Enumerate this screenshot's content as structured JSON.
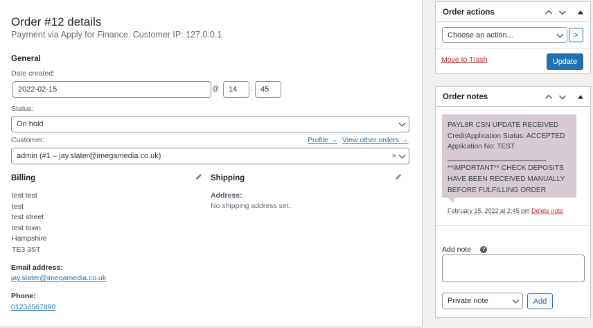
{
  "order": {
    "title": "Order #12 details",
    "subtitle": "Payment via Apply for Finance. Customer IP: 127.0.0.1"
  },
  "general": {
    "heading": "General",
    "date_label": "Date created:",
    "date_value": "2022-02-15",
    "at_sep": "@",
    "hour": "14",
    "colon_sep": ":",
    "minute": "45",
    "status_label": "Status:",
    "status_value": "On hold",
    "customer_label": "Customer:",
    "profile_link": "Profile →",
    "other_orders_link": "View other orders →",
    "customer_value": "admin (#1 – jay.slater@imegamedia.co.uk)",
    "clear_symbol": "×"
  },
  "billing": {
    "heading": "Billing",
    "address_lines": [
      "test test",
      "test",
      "test street",
      "test town",
      "Hampshire",
      "TE3 3ST"
    ],
    "email_label": "Email address:",
    "email": "jay.slater@imegamedia.co.uk",
    "phone_label": "Phone:",
    "phone": "01234567890"
  },
  "shipping": {
    "heading": "Shipping",
    "address_label": "Address:",
    "address_value": "No shipping address set."
  },
  "order_actions": {
    "title": "Order actions",
    "select_value": "Choose an action...",
    "go_symbol": ">",
    "trash_label": "Move to Trash",
    "update_label": "Update"
  },
  "order_notes": {
    "title": "Order notes",
    "note_lines": [
      "PAYL8R CSN UPDATE RECEIVED",
      "CreditApplication Status: ACCEPTED",
      "Application No: TEST",
      "____________________________",
      "**IMPORTANT** CHECK DEPOSITS",
      "HAVE BEEN RECEIVED MANUALLY",
      "BEFORE FULFILLING ORDER"
    ],
    "note_date": "February 15, 2022 at 2:45 pm",
    "delete_label": "Delete note",
    "add_note_label": "Add note",
    "help_symbol": "?",
    "note_type_value": "Private note",
    "add_button": "Add"
  },
  "colors": {
    "accent": "#2271b1",
    "danger": "#b32d2e",
    "note_bg": "#d7cad2"
  }
}
